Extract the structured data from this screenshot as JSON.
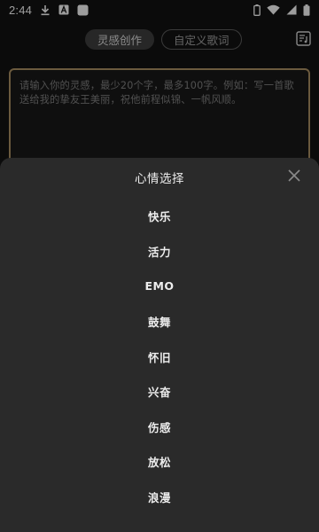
{
  "status_bar": {
    "time": "2:44",
    "icons": [
      "download-icon",
      "font-a-icon",
      "square-app-icon",
      "battery-outline-icon",
      "wifi-icon",
      "signal-icon",
      "battery-icon"
    ]
  },
  "header": {
    "tabs": [
      {
        "label": "灵感创作",
        "active": true
      },
      {
        "label": "自定义歌词",
        "active": false
      }
    ],
    "right_icon": "lyrics-note-icon"
  },
  "inspiration": {
    "placeholder": "请输入你的灵感，最少20个字，最多100字。例如：写一首歌送给我的挚友王美丽，祝他前程似锦、一帆风顺。"
  },
  "mood_sheet": {
    "title": "心情选择",
    "close_icon": "close-icon",
    "moods": [
      "快乐",
      "活力",
      "EMO",
      "鼓舞",
      "怀旧",
      "兴奋",
      "伤感",
      "放松",
      "浪漫"
    ]
  },
  "colors": {
    "background": "#111111",
    "sheet": "#2a2a2a",
    "accent_border": "#a58a60"
  }
}
